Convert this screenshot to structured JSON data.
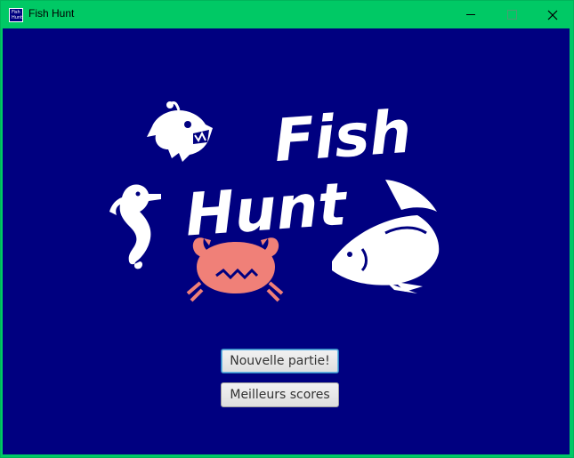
{
  "window": {
    "title": "Fish Hunt",
    "titlebar_color": "#00c965",
    "background_color": "#000080"
  },
  "app_icon": {
    "lines": [
      "Fish",
      "Hunt"
    ]
  },
  "logo": {
    "line1": "Fish",
    "line2": "Hunt",
    "text_color": "#ffffff",
    "crab_color": "#f08078"
  },
  "menu": {
    "new_game_label": "Nouvelle partie!",
    "high_scores_label": "Meilleurs scores"
  }
}
